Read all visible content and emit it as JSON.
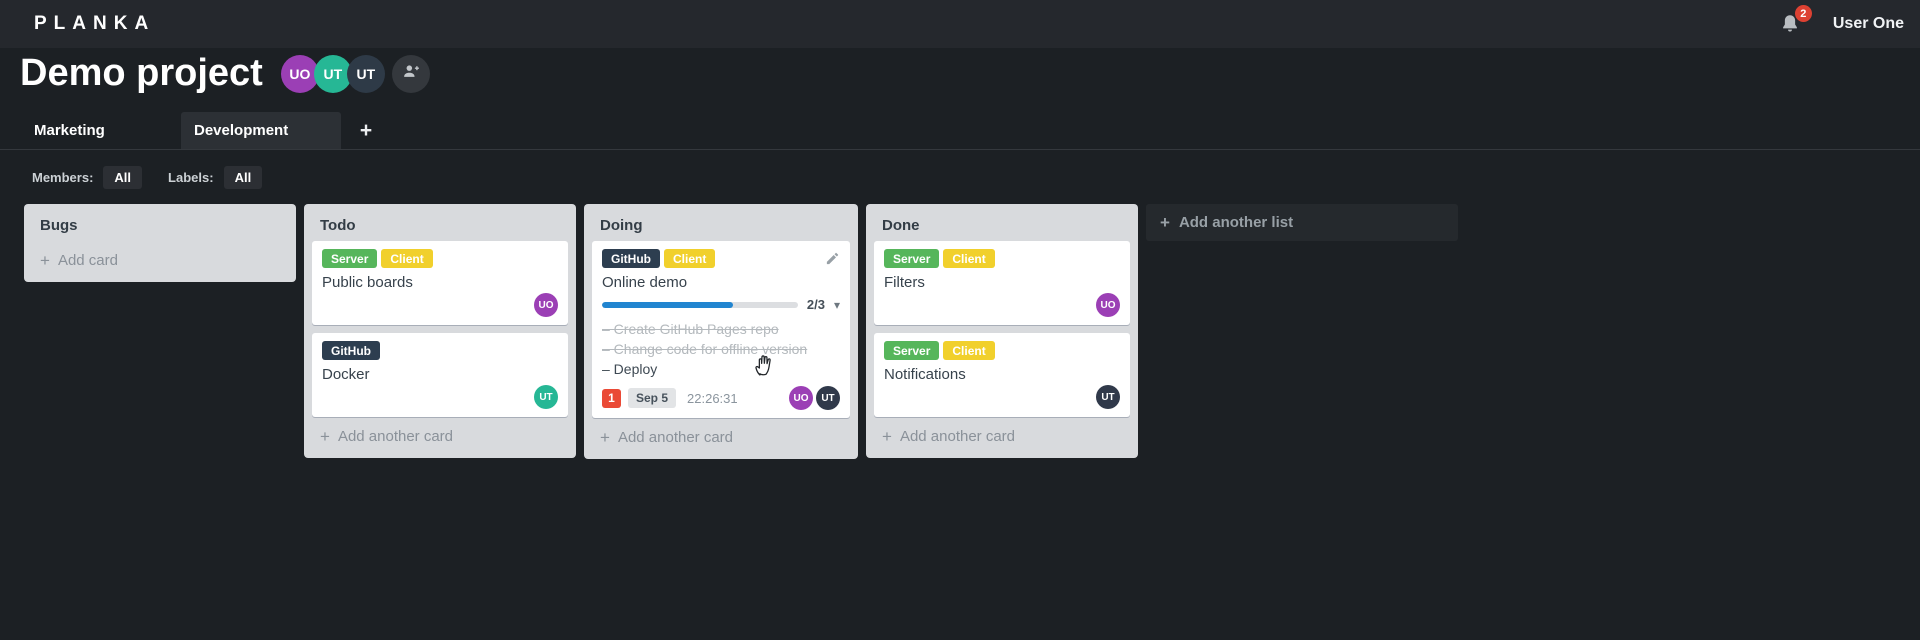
{
  "topbar": {
    "logo": "PLANKA",
    "notifications_count": "2",
    "user_name": "User One"
  },
  "header": {
    "title": "Demo project",
    "avatars": [
      {
        "initials": "UO",
        "color": "#9b3fb5"
      },
      {
        "initials": "UT",
        "color": "#26b795"
      },
      {
        "initials": "UT",
        "color": "#2e3a47"
      }
    ]
  },
  "tabs": {
    "items": [
      {
        "label": "Marketing",
        "active": false
      },
      {
        "label": "Development",
        "active": true
      }
    ],
    "add_label": "+"
  },
  "filters": {
    "members_label": "Members:",
    "members_value": "All",
    "labels_label": "Labels:",
    "labels_value": "All"
  },
  "board": {
    "add_list_label": "Add another list",
    "plus": "+",
    "lists": [
      {
        "title": "Bugs",
        "add_label": "Add card",
        "cards": []
      },
      {
        "title": "Todo",
        "add_label": "Add another card",
        "cards": [
          {
            "title": "Public boards",
            "labels": [
              {
                "text": "Server",
                "color": "#56b65b"
              },
              {
                "text": "Client",
                "color": "#f1d02c"
              }
            ],
            "members": [
              {
                "initials": "UO",
                "color": "#9b3fb5"
              }
            ]
          },
          {
            "title": "Docker",
            "labels": [
              {
                "text": "GitHub",
                "color": "#2d3e50"
              }
            ],
            "members": [
              {
                "initials": "UT",
                "color": "#26b795"
              }
            ]
          }
        ]
      },
      {
        "title": "Doing",
        "add_label": "Add another card",
        "cards": [
          {
            "title": "Online demo",
            "labels": [
              {
                "text": "GitHub",
                "color": "#2d3e50"
              },
              {
                "text": "Client",
                "color": "#f1d02c"
              }
            ],
            "progress": {
              "label": "2/3",
              "width": "66.7%",
              "color": "#2185d0",
              "caret": "▾"
            },
            "tasks": [
              {
                "text": "– Create GitHub Pages repo",
                "done": true
              },
              {
                "text": "– Change code for offline version",
                "done": true
              },
              {
                "text": "– Deploy",
                "done": false
              }
            ],
            "notification": {
              "count": "1",
              "color": "#ea4a36"
            },
            "due_date": "Sep 5",
            "timer": "22:26:31",
            "members": [
              {
                "initials": "UO",
                "color": "#9b3fb5"
              },
              {
                "initials": "UT",
                "color": "#30394a"
              }
            ]
          }
        ]
      },
      {
        "title": "Done",
        "add_label": "Add another card",
        "cards": [
          {
            "title": "Filters",
            "labels": [
              {
                "text": "Server",
                "color": "#56b65b"
              },
              {
                "text": "Client",
                "color": "#f1d02c"
              }
            ],
            "members": [
              {
                "initials": "UO",
                "color": "#9b3fb5"
              }
            ]
          },
          {
            "title": "Notifications",
            "labels": [
              {
                "text": "Server",
                "color": "#56b65b"
              },
              {
                "text": "Client",
                "color": "#f1d02c"
              }
            ],
            "members": [
              {
                "initials": "UT",
                "color": "#30394a"
              }
            ]
          }
        ]
      }
    ]
  }
}
